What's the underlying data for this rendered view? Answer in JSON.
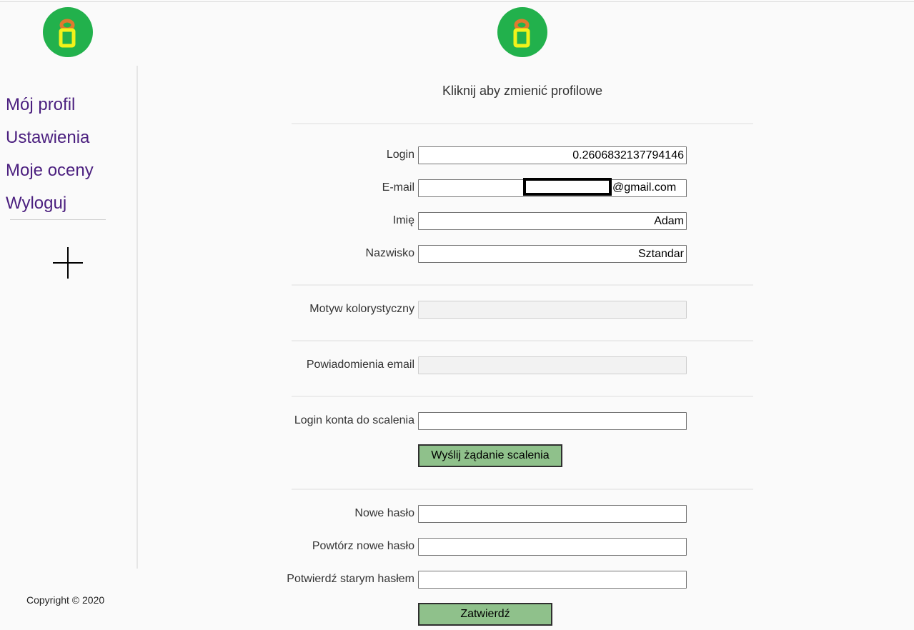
{
  "sidebar": {
    "items": [
      {
        "label": "Mój profil"
      },
      {
        "label": "Ustawienia"
      },
      {
        "label": "Moje oceny"
      },
      {
        "label": "Wyloguj"
      }
    ],
    "copyright": "Copyright © 2020"
  },
  "profile": {
    "change_photo_label": "Kliknij aby zmienić profilowe"
  },
  "fields": {
    "login_label": "Login",
    "login_value": "0.2606832137794146",
    "email_label": "E-mail",
    "email_domain": "@gmail.com",
    "first_name_label": "Imię",
    "first_name_value": "Adam",
    "last_name_label": "Nazwisko",
    "last_name_value": "Sztandar",
    "theme_label": "Motyw kolorystyczny",
    "notifications_label": "Powiadomienia email",
    "merge_login_label": "Login konta do scalenia",
    "new_password_label": "Nowe hasło",
    "repeat_password_label": "Powtórz nowe hasło",
    "old_password_label": "Potwierdź starym hasłem"
  },
  "buttons": {
    "send_merge_request": "Wyślij żądanie scalenia",
    "confirm": "Zatwierdź"
  },
  "colors": {
    "logo_bg": "#22b14c",
    "logo_top_ring": "#e07a2e",
    "logo_bottom_ring": "#f2f21a",
    "nav_link": "#4b1f7f",
    "button_bg": "#8fc18b"
  },
  "icons": {
    "logo": "app-logo-icon",
    "add": "plus-icon"
  }
}
